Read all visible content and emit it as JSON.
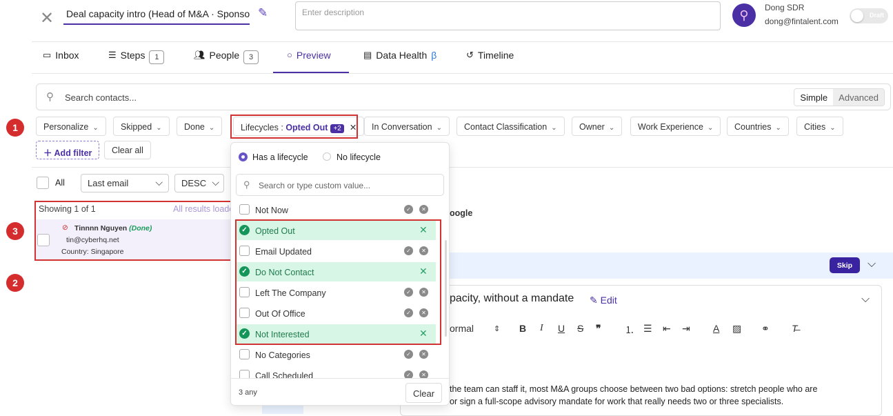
{
  "header": {
    "title": "Deal capacity intro (Head of M&A · Sponsor",
    "description_placeholder": "Enter description",
    "user_name": "Dong SDR",
    "user_email": "dong@fintalent.com",
    "toggle_label": "Draft"
  },
  "tabs": [
    {
      "label": "Inbox",
      "icon": "inbox-icon"
    },
    {
      "label": "Steps",
      "count": "1",
      "icon": "list-icon"
    },
    {
      "label": "People",
      "count": "3",
      "icon": "people-icon"
    },
    {
      "label": "Preview",
      "icon": "search-icon",
      "active": true
    },
    {
      "label": "Data Health",
      "suffix": "β",
      "icon": "data-health-icon"
    },
    {
      "label": "Timeline",
      "icon": "history-icon"
    }
  ],
  "search": {
    "placeholder": "Search contacts...",
    "mode_simple": "Simple",
    "mode_advanced": "Advanced"
  },
  "filters": {
    "personalize": "Personalize",
    "skipped": "Skipped",
    "done": "Done",
    "lifecycles_label": "Lifecycles :",
    "lifecycles_value": "Opted Out",
    "lifecycles_more": "+2",
    "in_conversation": "In Conversation",
    "contact_classification": "Contact Classification",
    "owner": "Owner",
    "work_experience": "Work Experience",
    "countries": "Countries",
    "cities": "Cities",
    "add_filter": "Add filter",
    "clear_all": "Clear all"
  },
  "list": {
    "all_label": "All",
    "sort_field": "Last email",
    "sort_order": "DESC",
    "showing": "Showing 1 of 1",
    "all_loaded": "All results loaded",
    "contact": {
      "name": "Tinnnn Nguyen",
      "status": "(Done)",
      "email": "tin@cyberhq.net",
      "country": "Country: Singapore"
    }
  },
  "dropdown": {
    "has_lifecycle": "Has a lifecycle",
    "no_lifecycle": "No lifecycle",
    "search_placeholder": "Search or type custom value...",
    "items": [
      {
        "label": "Not Now",
        "selected": false
      },
      {
        "label": "Opted Out",
        "selected": true
      },
      {
        "label": "Email Updated",
        "selected": false
      },
      {
        "label": "Do Not Contact",
        "selected": true
      },
      {
        "label": "Left The Company",
        "selected": false
      },
      {
        "label": "Out Of Office",
        "selected": false
      },
      {
        "label": "Not Interested",
        "selected": true
      },
      {
        "label": "No Categories",
        "selected": false
      },
      {
        "label": "Call Scheduled",
        "selected": false
      }
    ],
    "footer_mode": "3 any",
    "clear": "Clear"
  },
  "preview": {
    "company_fragment": "oogle",
    "skip": "Skip",
    "step_title": "pacity, without a mandate",
    "edit": "Edit",
    "format": "ormal",
    "body_line1": "the team can staff it, most M&A groups choose between two bad options: stretch people who are",
    "body_line2": "or sign a full-scope advisory mandate for work that really needs two or three specialists."
  },
  "annotations": [
    "1",
    "2",
    "3"
  ],
  "colors": {
    "accent": "#4a2fa5",
    "annotation_red": "#d23232",
    "selected_bg": "#d8f6e5",
    "selected_check": "#14955a"
  }
}
